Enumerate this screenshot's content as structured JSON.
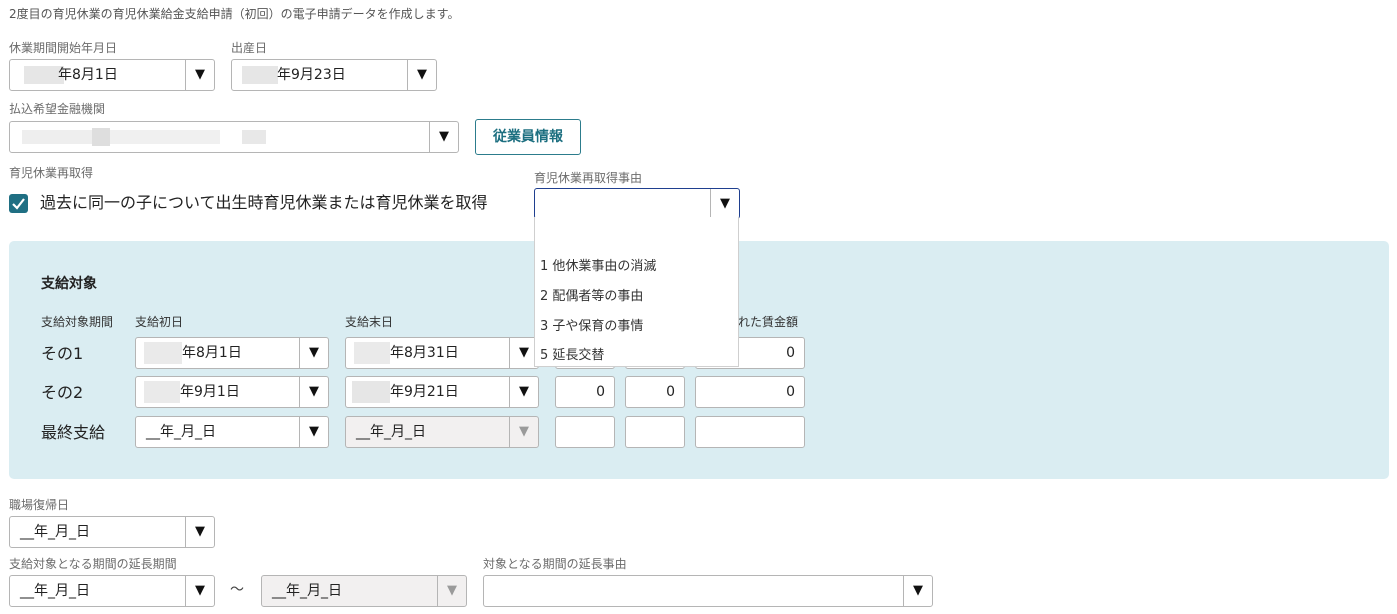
{
  "description": "2度目の育児休業の育児休業給金支給申請（初回）の電子申請データを作成します。",
  "leave_start": {
    "label": "休業期間開始年月日",
    "value": "年8月1日"
  },
  "birth_date": {
    "label": "出産日",
    "value": "年9月23日"
  },
  "bank": {
    "label": "払込希望金融機関",
    "value": ""
  },
  "employee_button": "従業員情報",
  "reacquire": {
    "label": "育児休業再取得",
    "checkbox_text": "過去に同一の子について出生時育児休業または育児休業を取得"
  },
  "reacquire_reason": {
    "label": "育児休業再取得事由",
    "value": "",
    "options": [
      "",
      "1 他休業事由の消滅",
      "2 配偶者等の事由",
      "3 子や保育の事情",
      "5 延長交替"
    ]
  },
  "payment": {
    "title": "支給対象",
    "headers": {
      "period": "支給対象期間",
      "first_day": "支給初日",
      "last_day": "支給末日",
      "wage_partial": "れた賃金額"
    },
    "rows": [
      {
        "label": "その1",
        "first": "年8月1日",
        "last": "年8月31日",
        "n1": "",
        "n2": "",
        "n3": "0"
      },
      {
        "label": "その2",
        "first": "年9月1日",
        "last": "年9月21日",
        "n1": "0",
        "n2": "0",
        "n3": "0"
      },
      {
        "label": "最終支給",
        "first": "__年_月_日",
        "last": "__年_月_日",
        "n1": "",
        "n2": "",
        "n3": ""
      }
    ]
  },
  "return_date": {
    "label": "職場復帰日",
    "value": "__年_月_日"
  },
  "extension": {
    "label": "支給対象となる期間の延長期間",
    "from": "__年_月_日",
    "tilde": "〜",
    "to": "__年_月_日"
  },
  "extension_reason": {
    "label": "対象となる期間の延長事由",
    "value": ""
  },
  "caret_glyph": "▼"
}
